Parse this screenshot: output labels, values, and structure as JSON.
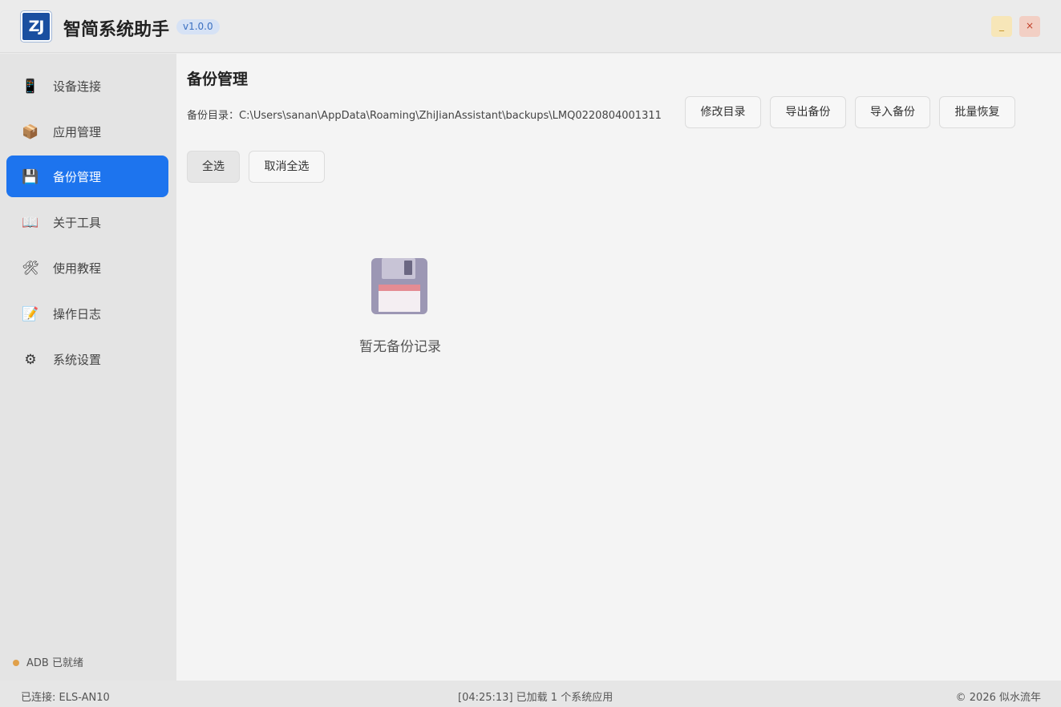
{
  "app": {
    "logo_text": "ZJ",
    "title": "智简系统助手",
    "version": "v1.0.0",
    "minimize_label": "_",
    "close_label": "×"
  },
  "sidebar": {
    "items": [
      {
        "label": "设备连接",
        "icon": "phone-icon",
        "glyph": "📱"
      },
      {
        "label": "应用管理",
        "icon": "package-icon",
        "glyph": "📦"
      },
      {
        "label": "备份管理",
        "icon": "floppy-disk-icon",
        "glyph": "💾"
      },
      {
        "label": "关于工具",
        "icon": "open-book-icon",
        "glyph": "📖"
      },
      {
        "label": "使用教程",
        "icon": "hammer-wrench-icon",
        "glyph": "🛠"
      },
      {
        "label": "操作日志",
        "icon": "memo-icon",
        "glyph": "📝"
      },
      {
        "label": "系统设置",
        "icon": "gear-icon",
        "glyph": "⚙"
      }
    ],
    "active_index": 2,
    "adb_status": "ADB 已就绪"
  },
  "main": {
    "title": "备份管理",
    "backup_dir": "备份目录：C:\\Users\\sanan\\AppData\\Roaming\\ZhiJianAssistant\\backups\\LMQ0220804001311",
    "buttons": {
      "change_dir": "修改目录",
      "export_backup": "导出备份",
      "import_backup": "导入备份",
      "batch_restore": "批量恢复",
      "select_all": "全选",
      "deselect_all": "取消全选"
    },
    "empty_text": "暂无备份记录"
  },
  "statusbar": {
    "connected": "已连接: ELS-AN10",
    "message": "[04:25:13] 已加载 1 个系统应用",
    "copyright": "© 2026 似水流年"
  },
  "colors": {
    "accent": "#1d74ee",
    "adb_dot": "#e0a04a"
  }
}
